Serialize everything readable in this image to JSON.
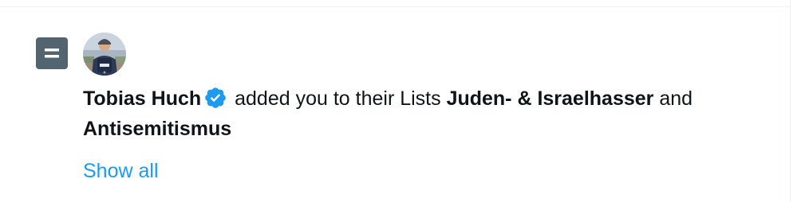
{
  "notification": {
    "actor_name": "Tobias Huch",
    "actor_verified": true,
    "action_text": " added you to their Lists ",
    "list_one": "Juden- & Israelhasser",
    "conjunction": " and",
    "list_two": "Antisemitismus",
    "show_all_label": "Show all",
    "icon": "list-icon",
    "verified_icon": "verified-badge-icon"
  },
  "colors": {
    "list_icon_bg": "#536471",
    "link": "#1d9bf0",
    "verified": "#1d9bf0",
    "text": "#0f1419"
  }
}
